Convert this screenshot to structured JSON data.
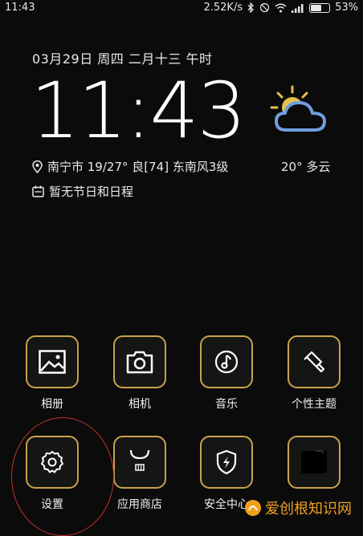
{
  "status": {
    "time": "11:43",
    "speed": "2.52K/s",
    "battery": "53%"
  },
  "lock": {
    "date": "03月29日 周四 二月十三 午时",
    "clock": "11:43",
    "location": "南宁市 19/27° 良[74] 东南风3级",
    "temperature": "20° 多云",
    "calendar": "暂无节日和日程"
  },
  "apps": [
    {
      "label": "相册",
      "icon": "gallery-icon"
    },
    {
      "label": "相机",
      "icon": "camera-icon"
    },
    {
      "label": "音乐",
      "icon": "music-icon"
    },
    {
      "label": "个性主题",
      "icon": "theme-brush-icon"
    },
    {
      "label": "设置",
      "icon": "gear-icon"
    },
    {
      "label": "应用商店",
      "icon": "app-store-bag-icon"
    },
    {
      "label": "安全中心",
      "icon": "shield-bolt-icon"
    },
    {
      "label": "",
      "icon": "folder-icon"
    }
  ],
  "watermark": {
    "text": "爱创根知识网"
  },
  "colors": {
    "accent": "#c9a24a",
    "highlight": "#c0322a",
    "background": "#0b0b0b"
  }
}
